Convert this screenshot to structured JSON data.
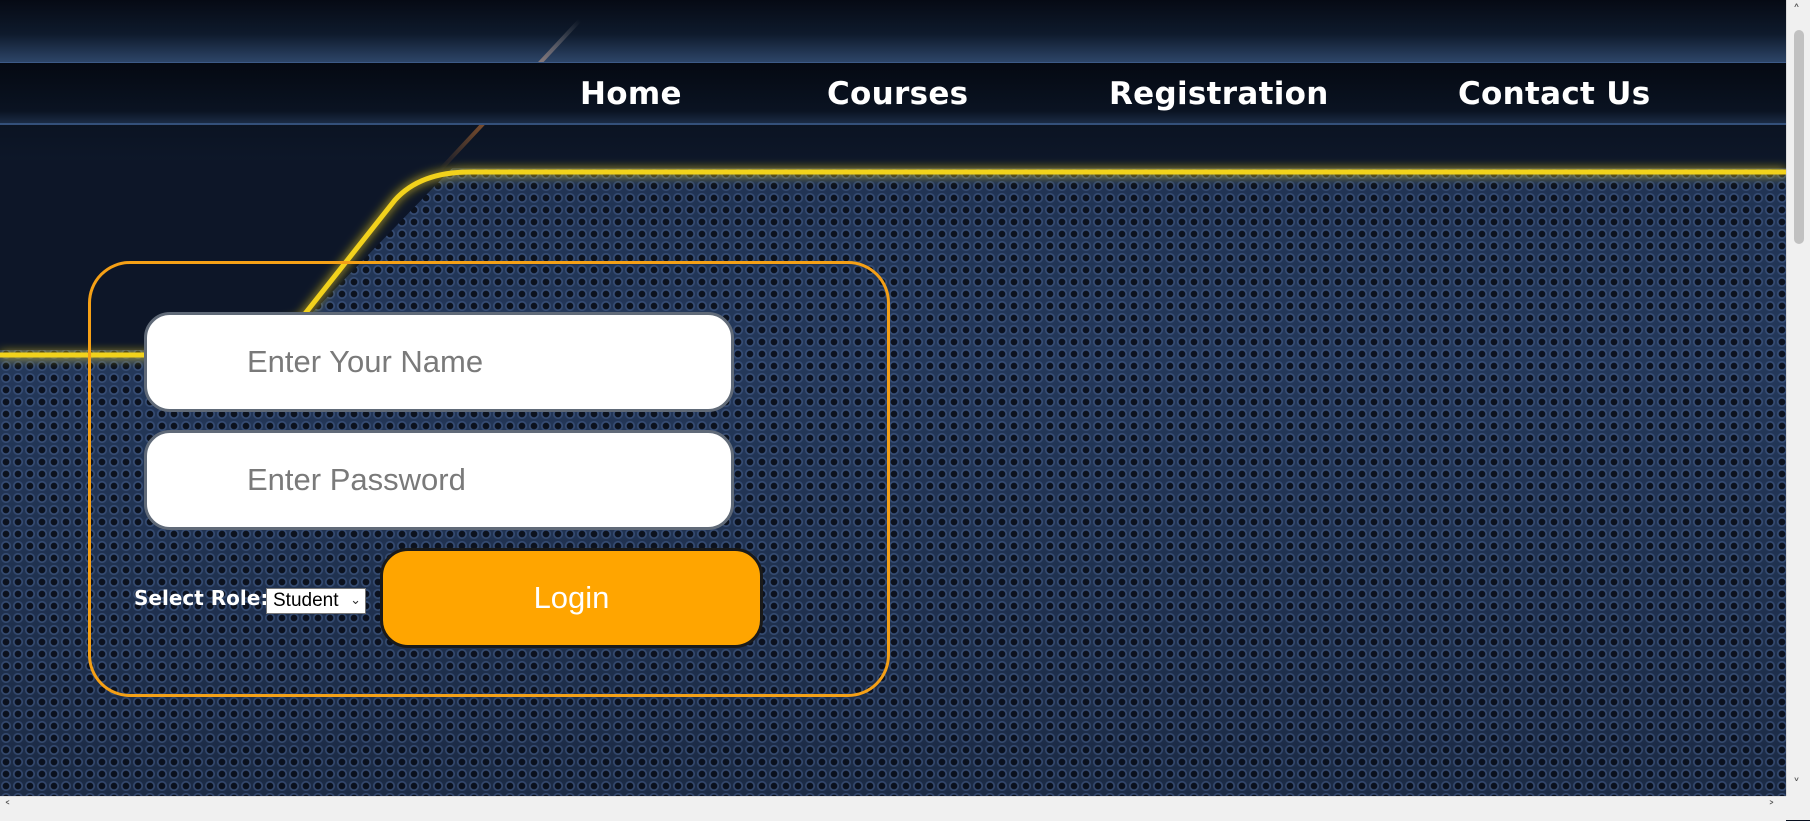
{
  "nav": {
    "items": [
      {
        "label": "Home"
      },
      {
        "label": "Courses"
      },
      {
        "label": "Registration"
      },
      {
        "label": "Contact Us"
      }
    ]
  },
  "login": {
    "name_placeholder": "Enter Your Name",
    "name_value": "",
    "password_placeholder": "Enter Password",
    "password_value": "",
    "role_label": "Select Role:",
    "role_selected": "Student",
    "button_label": "Login"
  },
  "colors": {
    "accent": "#ffa500",
    "panel_border": "#f5a016",
    "gold_line": "#f2d21e",
    "nav_text": "#ffffff"
  },
  "icons": {
    "select_chevron": "chevron-down-icon",
    "scroll_up": "chevron-up-icon",
    "scroll_down": "chevron-down-icon",
    "scroll_left": "chevron-left-icon",
    "scroll_right": "chevron-right-icon"
  }
}
